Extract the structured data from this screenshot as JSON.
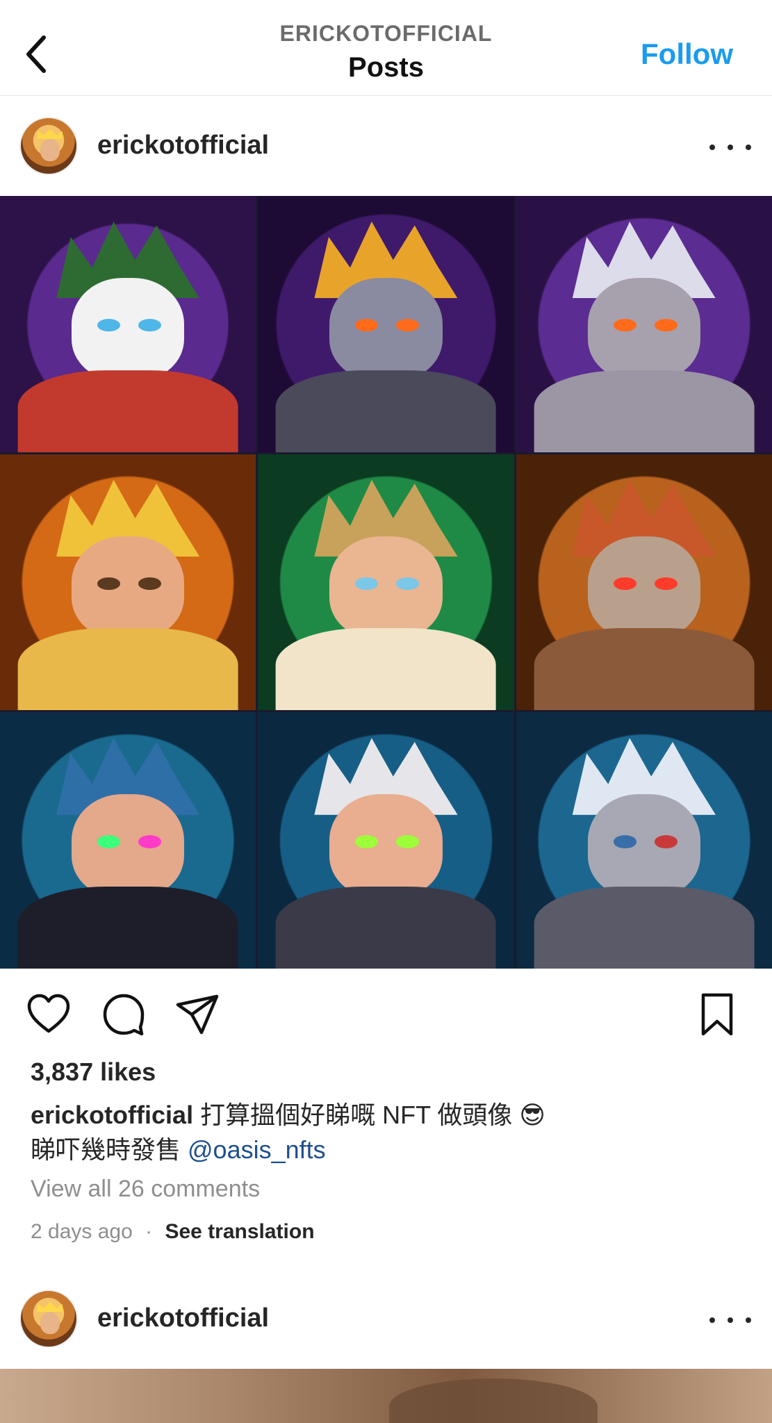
{
  "header": {
    "subtitle": "ERICKOTOFFICIAL",
    "title": "Posts",
    "follow_label": "Follow"
  },
  "post": {
    "username": "erickotofficial",
    "likes": "3,837 likes",
    "caption_user": "erickotofficial",
    "caption_text": "打算搵個好睇嘅 NFT 做頭像 😎",
    "caption_line2": "睇吓幾時發售 ",
    "mention": "@oasis_nfts",
    "view_comments": "View all 26 comments",
    "time_ago": "2 days ago",
    "dot": "·",
    "see_translation": "See translation",
    "grid_tiles": [
      "joker-avatar",
      "demon-king-avatar",
      "elf-warrior-avatar",
      "king-avatar",
      "prince-avatar",
      "skull-mask-avatar",
      "cyber-goggles-avatar",
      "green-visor-avatar",
      "ninja-mask-avatar"
    ]
  },
  "next_post": {
    "username": "erickotofficial"
  },
  "icons": {
    "back": "chevron-left-icon",
    "more": "more-dots-icon",
    "like": "heart-icon",
    "comment": "comment-bubble-icon",
    "share": "paper-plane-icon",
    "save": "bookmark-icon"
  },
  "colors": {
    "accent": "#1a9bf0",
    "mention": "#1d4f8c",
    "muted": "#8e8e8e"
  }
}
